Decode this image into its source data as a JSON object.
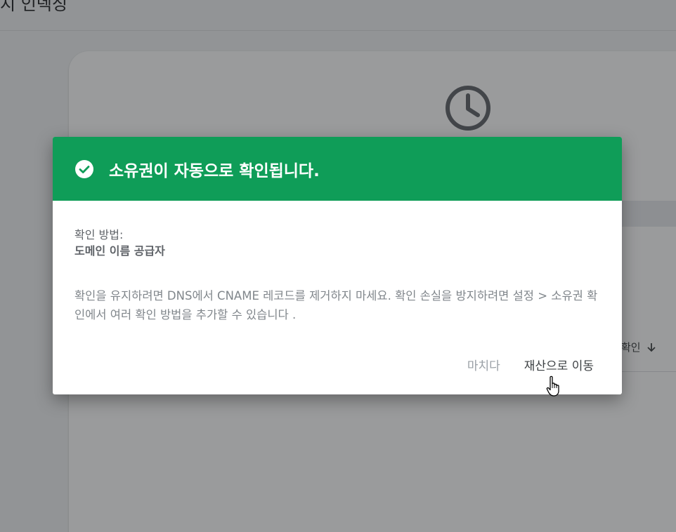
{
  "background": {
    "page_title": "지 인덱싱",
    "sort_label": "확인",
    "clock_icon": "clock-icon",
    "sort_icon": "arrow-down-icon"
  },
  "dialog": {
    "title": "소유권이 자동으로 확인됩니다.",
    "title_icon": "check-circle-icon",
    "header_color": "#0f9d58",
    "method_label": "확인 방법:",
    "method_value": "도메인 이름 공급자",
    "info_text": "확인을 유지하려면 DNS에서 CNAME 레코드를 제거하지 마세요. 확인 손실을 방지하려면 설정 > 소유권 확인에서 여러 확인 방법을 추가할 수 있습니다 .",
    "actions": {
      "done_label": "마치다",
      "go_to_property_label": "재산으로 이동"
    }
  }
}
